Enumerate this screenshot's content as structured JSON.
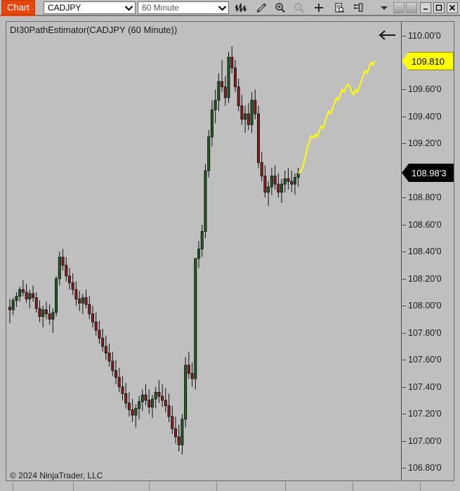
{
  "window": {
    "tab_label": "Chart",
    "accent_color": "#e8470c",
    "background_color": "#bfbfbf"
  },
  "toolbar": {
    "symbol_select": {
      "value": "CADJPY",
      "icon": "chevron-down-icon"
    },
    "interval_select": {
      "value": "60 Minute",
      "icon": "chevron-down-icon"
    },
    "buttons": [
      {
        "name": "bar-chart-icon",
        "title": "Chart type"
      },
      {
        "name": "pencil-icon",
        "title": "Drawing tools"
      },
      {
        "name": "zoom-in-icon",
        "title": "Zoom in"
      },
      {
        "name": "zoom-out-icon",
        "title": "Zoom out",
        "disabled": true
      },
      {
        "name": "crosshair-icon",
        "title": "Crosshair"
      },
      {
        "name": "data-box-icon",
        "title": "Data box"
      },
      {
        "name": "panel-icon",
        "title": "Indicators panel"
      }
    ],
    "overflow_icon": "chevron-down-icon",
    "window_controls": [
      {
        "name": "restore-square-button",
        "glyph": ""
      },
      {
        "name": "restore-square-button-2",
        "glyph": ""
      },
      {
        "name": "minimize-button",
        "glyph": "minimize-icon"
      },
      {
        "name": "maximize-button",
        "glyph": "maximize-icon"
      },
      {
        "name": "close-button",
        "glyph": "close-icon"
      }
    ]
  },
  "chart": {
    "title": "DI30PathEstimator(CADJPY (60 Minute))",
    "back_arrow_icon": "arrow-left-icon",
    "footer": "© 2024 NinjaTrader, LLC",
    "up_color": "#1d5c20",
    "down_color": "#8e1b1b",
    "forecast_color": "#ffff00",
    "wick_color": "#101010"
  },
  "price_axis": {
    "ticks": [
      {
        "label": "110.00'0",
        "value": 110.0
      },
      {
        "label": "109.60'0",
        "value": 109.6
      },
      {
        "label": "109.40'0",
        "value": 109.4
      },
      {
        "label": "109.20'0",
        "value": 109.2
      },
      {
        "label": "108.80'0",
        "value": 108.8
      },
      {
        "label": "108.60'0",
        "value": 108.6
      },
      {
        "label": "108.40'0",
        "value": 108.4
      },
      {
        "label": "108.20'0",
        "value": 108.2
      },
      {
        "label": "108.00'0",
        "value": 108.0
      },
      {
        "label": "107.80'0",
        "value": 107.8
      },
      {
        "label": "107.60'0",
        "value": 107.6
      },
      {
        "label": "107.40'0",
        "value": 107.4
      },
      {
        "label": "107.20'0",
        "value": 107.2
      },
      {
        "label": "107.00'0",
        "value": 107.0
      },
      {
        "label": "106.80'0",
        "value": 106.8
      }
    ],
    "markers": [
      {
        "name": "forecast-price",
        "label": "109.810",
        "value": 109.81,
        "background": "#ffff00",
        "text_color": "#000000"
      },
      {
        "name": "last-price",
        "label": "108.98'3",
        "value": 108.983,
        "background": "#000000",
        "text_color": "#ffffff"
      }
    ]
  },
  "chart_data": {
    "type": "candlestick",
    "title": "DI30PathEstimator(CADJPY (60 Minute))",
    "xlabel": "",
    "ylabel": "",
    "ylim": [
      106.72,
      110.1
    ],
    "grid": false,
    "legend": false,
    "instrument": "CADJPY",
    "interval": "60 Minute",
    "last_price": 108.983,
    "forecast_end_price": 109.81,
    "ohlc": [
      [
        107.99,
        108.05,
        107.87,
        107.97
      ],
      [
        107.97,
        108.06,
        107.93,
        108.04
      ],
      [
        108.04,
        108.1,
        107.99,
        108.07
      ],
      [
        108.07,
        108.14,
        108.03,
        108.12
      ],
      [
        108.12,
        108.19,
        108.07,
        108.1
      ],
      [
        108.1,
        108.16,
        108.02,
        108.05
      ],
      [
        108.05,
        108.12,
        107.98,
        108.09
      ],
      [
        108.09,
        108.15,
        108.03,
        108.06
      ],
      [
        108.06,
        108.1,
        107.95,
        107.98
      ],
      [
        107.98,
        108.04,
        107.88,
        107.92
      ],
      [
        107.92,
        108.0,
        107.84,
        107.97
      ],
      [
        107.97,
        108.03,
        107.9,
        107.94
      ],
      [
        107.94,
        108.01,
        107.86,
        107.9
      ],
      [
        107.9,
        107.98,
        107.8,
        107.95
      ],
      [
        107.95,
        108.22,
        107.92,
        108.2
      ],
      [
        108.2,
        108.4,
        108.15,
        108.36
      ],
      [
        108.36,
        108.42,
        108.26,
        108.3
      ],
      [
        108.3,
        108.36,
        108.18,
        108.22
      ],
      [
        108.22,
        108.28,
        108.12,
        108.17
      ],
      [
        108.17,
        108.24,
        108.08,
        108.12
      ],
      [
        108.12,
        108.18,
        108.0,
        108.05
      ],
      [
        108.05,
        108.11,
        107.96,
        108.02
      ],
      [
        108.02,
        108.09,
        107.94,
        108.06
      ],
      [
        108.06,
        108.12,
        107.98,
        108.01
      ],
      [
        108.01,
        108.07,
        107.9,
        107.94
      ],
      [
        107.94,
        108.0,
        107.84,
        107.88
      ],
      [
        107.88,
        107.95,
        107.78,
        107.82
      ],
      [
        107.82,
        107.89,
        107.72,
        107.76
      ],
      [
        107.76,
        107.83,
        107.66,
        107.7
      ],
      [
        107.7,
        107.78,
        107.6,
        107.65
      ],
      [
        107.65,
        107.72,
        107.55,
        107.59
      ],
      [
        107.59,
        107.66,
        107.48,
        107.52
      ],
      [
        107.52,
        107.6,
        107.42,
        107.47
      ],
      [
        107.47,
        107.54,
        107.36,
        107.4
      ],
      [
        107.4,
        107.48,
        107.3,
        107.35
      ],
      [
        107.35,
        107.43,
        107.24,
        107.28
      ],
      [
        107.28,
        107.36,
        107.18,
        107.23
      ],
      [
        107.23,
        107.31,
        107.14,
        107.19
      ],
      [
        107.19,
        107.27,
        107.1,
        107.24
      ],
      [
        107.24,
        107.33,
        107.16,
        107.29
      ],
      [
        107.29,
        107.38,
        107.22,
        107.34
      ],
      [
        107.34,
        107.42,
        107.26,
        107.3
      ],
      [
        107.3,
        107.38,
        107.2,
        107.25
      ],
      [
        107.25,
        107.34,
        107.17,
        107.31
      ],
      [
        107.31,
        107.4,
        107.24,
        107.36
      ],
      [
        107.36,
        107.45,
        107.28,
        107.33
      ],
      [
        107.33,
        107.42,
        107.25,
        107.3
      ],
      [
        107.3,
        107.39,
        107.21,
        107.26
      ],
      [
        107.26,
        107.35,
        107.14,
        107.18
      ],
      [
        107.18,
        107.26,
        107.05,
        107.09
      ],
      [
        107.09,
        107.18,
        106.98,
        107.03
      ],
      [
        107.03,
        107.12,
        106.92,
        106.97
      ],
      [
        106.97,
        107.2,
        106.9,
        107.16
      ],
      [
        107.16,
        107.62,
        107.1,
        107.56
      ],
      [
        107.56,
        107.66,
        107.46,
        107.5
      ],
      [
        107.5,
        107.58,
        107.4,
        107.46
      ],
      [
        107.46,
        107.56,
        107.38,
        108.35
      ],
      [
        108.35,
        108.48,
        108.28,
        108.42
      ],
      [
        108.42,
        108.6,
        108.36,
        108.55
      ],
      [
        108.55,
        109.05,
        108.5,
        109.0
      ],
      [
        109.0,
        109.3,
        108.95,
        109.25
      ],
      [
        109.25,
        109.52,
        109.18,
        109.45
      ],
      [
        109.45,
        109.6,
        109.35,
        109.52
      ],
      [
        109.52,
        109.72,
        109.44,
        109.66
      ],
      [
        109.66,
        109.82,
        109.58,
        109.62
      ],
      [
        109.62,
        109.7,
        109.48,
        109.54
      ],
      [
        109.54,
        109.88,
        109.5,
        109.84
      ],
      [
        109.84,
        109.92,
        109.72,
        109.76
      ],
      [
        109.76,
        109.82,
        109.58,
        109.62
      ],
      [
        109.62,
        109.68,
        109.44,
        109.48
      ],
      [
        109.48,
        109.56,
        109.34,
        109.38
      ],
      [
        109.38,
        109.48,
        109.28,
        109.42
      ],
      [
        109.42,
        109.5,
        109.3,
        109.34
      ],
      [
        109.34,
        109.58,
        109.28,
        109.52
      ],
      [
        109.52,
        109.6,
        109.38,
        109.42
      ],
      [
        109.42,
        109.48,
        109.02,
        109.06
      ],
      [
        109.06,
        109.14,
        108.92,
        108.96
      ],
      [
        108.96,
        109.04,
        108.8,
        108.84
      ],
      [
        108.84,
        108.92,
        108.74,
        108.88
      ],
      [
        108.88,
        109.02,
        108.82,
        108.96
      ],
      [
        108.96,
        109.04,
        108.86,
        108.9
      ],
      [
        108.9,
        108.98,
        108.8,
        108.84
      ],
      [
        108.84,
        108.94,
        108.76,
        108.9
      ],
      [
        108.9,
        109.0,
        108.84,
        108.94
      ],
      [
        108.94,
        109.02,
        108.86,
        108.92
      ],
      [
        108.92,
        109.0,
        108.84,
        108.9
      ],
      [
        108.9,
        108.98,
        108.82,
        108.95
      ],
      [
        108.95,
        109.02,
        108.88,
        108.98
      ]
    ],
    "forecast": [
      108.98,
      108.99,
      109.01,
      109.06,
      109.12,
      109.18,
      109.22,
      109.26,
      109.24,
      109.27,
      109.25,
      109.29,
      109.33,
      109.31,
      109.36,
      109.4,
      109.44,
      109.42,
      109.46,
      109.5,
      109.54,
      109.52,
      109.56,
      109.6,
      109.58,
      109.62,
      109.64,
      109.62,
      109.58,
      109.56,
      109.6,
      109.58,
      109.62,
      109.66,
      109.7,
      109.74,
      109.72,
      109.76,
      109.8,
      109.78,
      109.81
    ]
  }
}
